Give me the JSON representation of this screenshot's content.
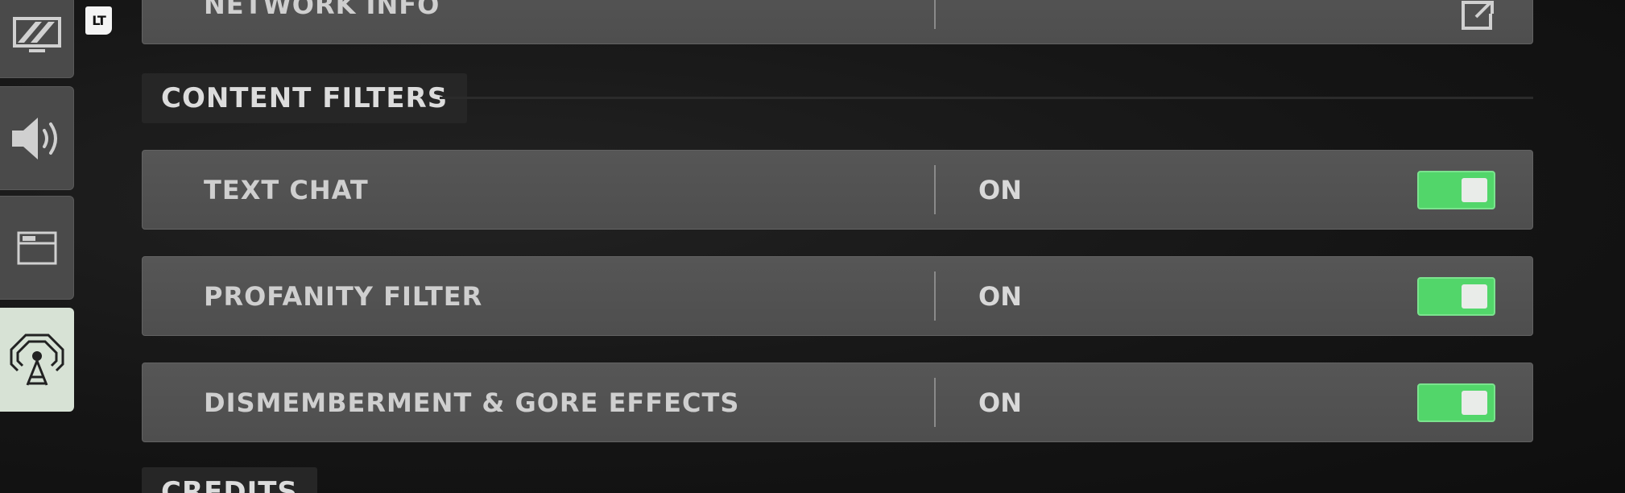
{
  "sidebar": {
    "tabs": [
      {
        "id": "graphics",
        "icon": "monitor-icon",
        "active": false
      },
      {
        "id": "audio",
        "icon": "speaker-icon",
        "active": false
      },
      {
        "id": "interface",
        "icon": "layout-icon",
        "active": false
      },
      {
        "id": "account-network",
        "icon": "network-tower-icon",
        "active": true
      }
    ],
    "bumper_hint": "LT"
  },
  "network_row": {
    "label": "NETWORK INFO",
    "icon": "external-link-icon"
  },
  "content_filters": {
    "title": "CONTENT FILTERS",
    "rows": [
      {
        "label": "TEXT CHAT",
        "value": "ON",
        "toggle_on": true
      },
      {
        "label": "PROFANITY FILTER",
        "value": "ON",
        "toggle_on": true
      },
      {
        "label": "DISMEMBERMENT & GORE EFFECTS",
        "value": "ON",
        "toggle_on": true
      }
    ]
  },
  "credits": {
    "title": "CREDITS"
  },
  "colors": {
    "toggle_on": "#52d66a",
    "active_tab": "#d7e2d5",
    "row_bg": "#525252"
  }
}
